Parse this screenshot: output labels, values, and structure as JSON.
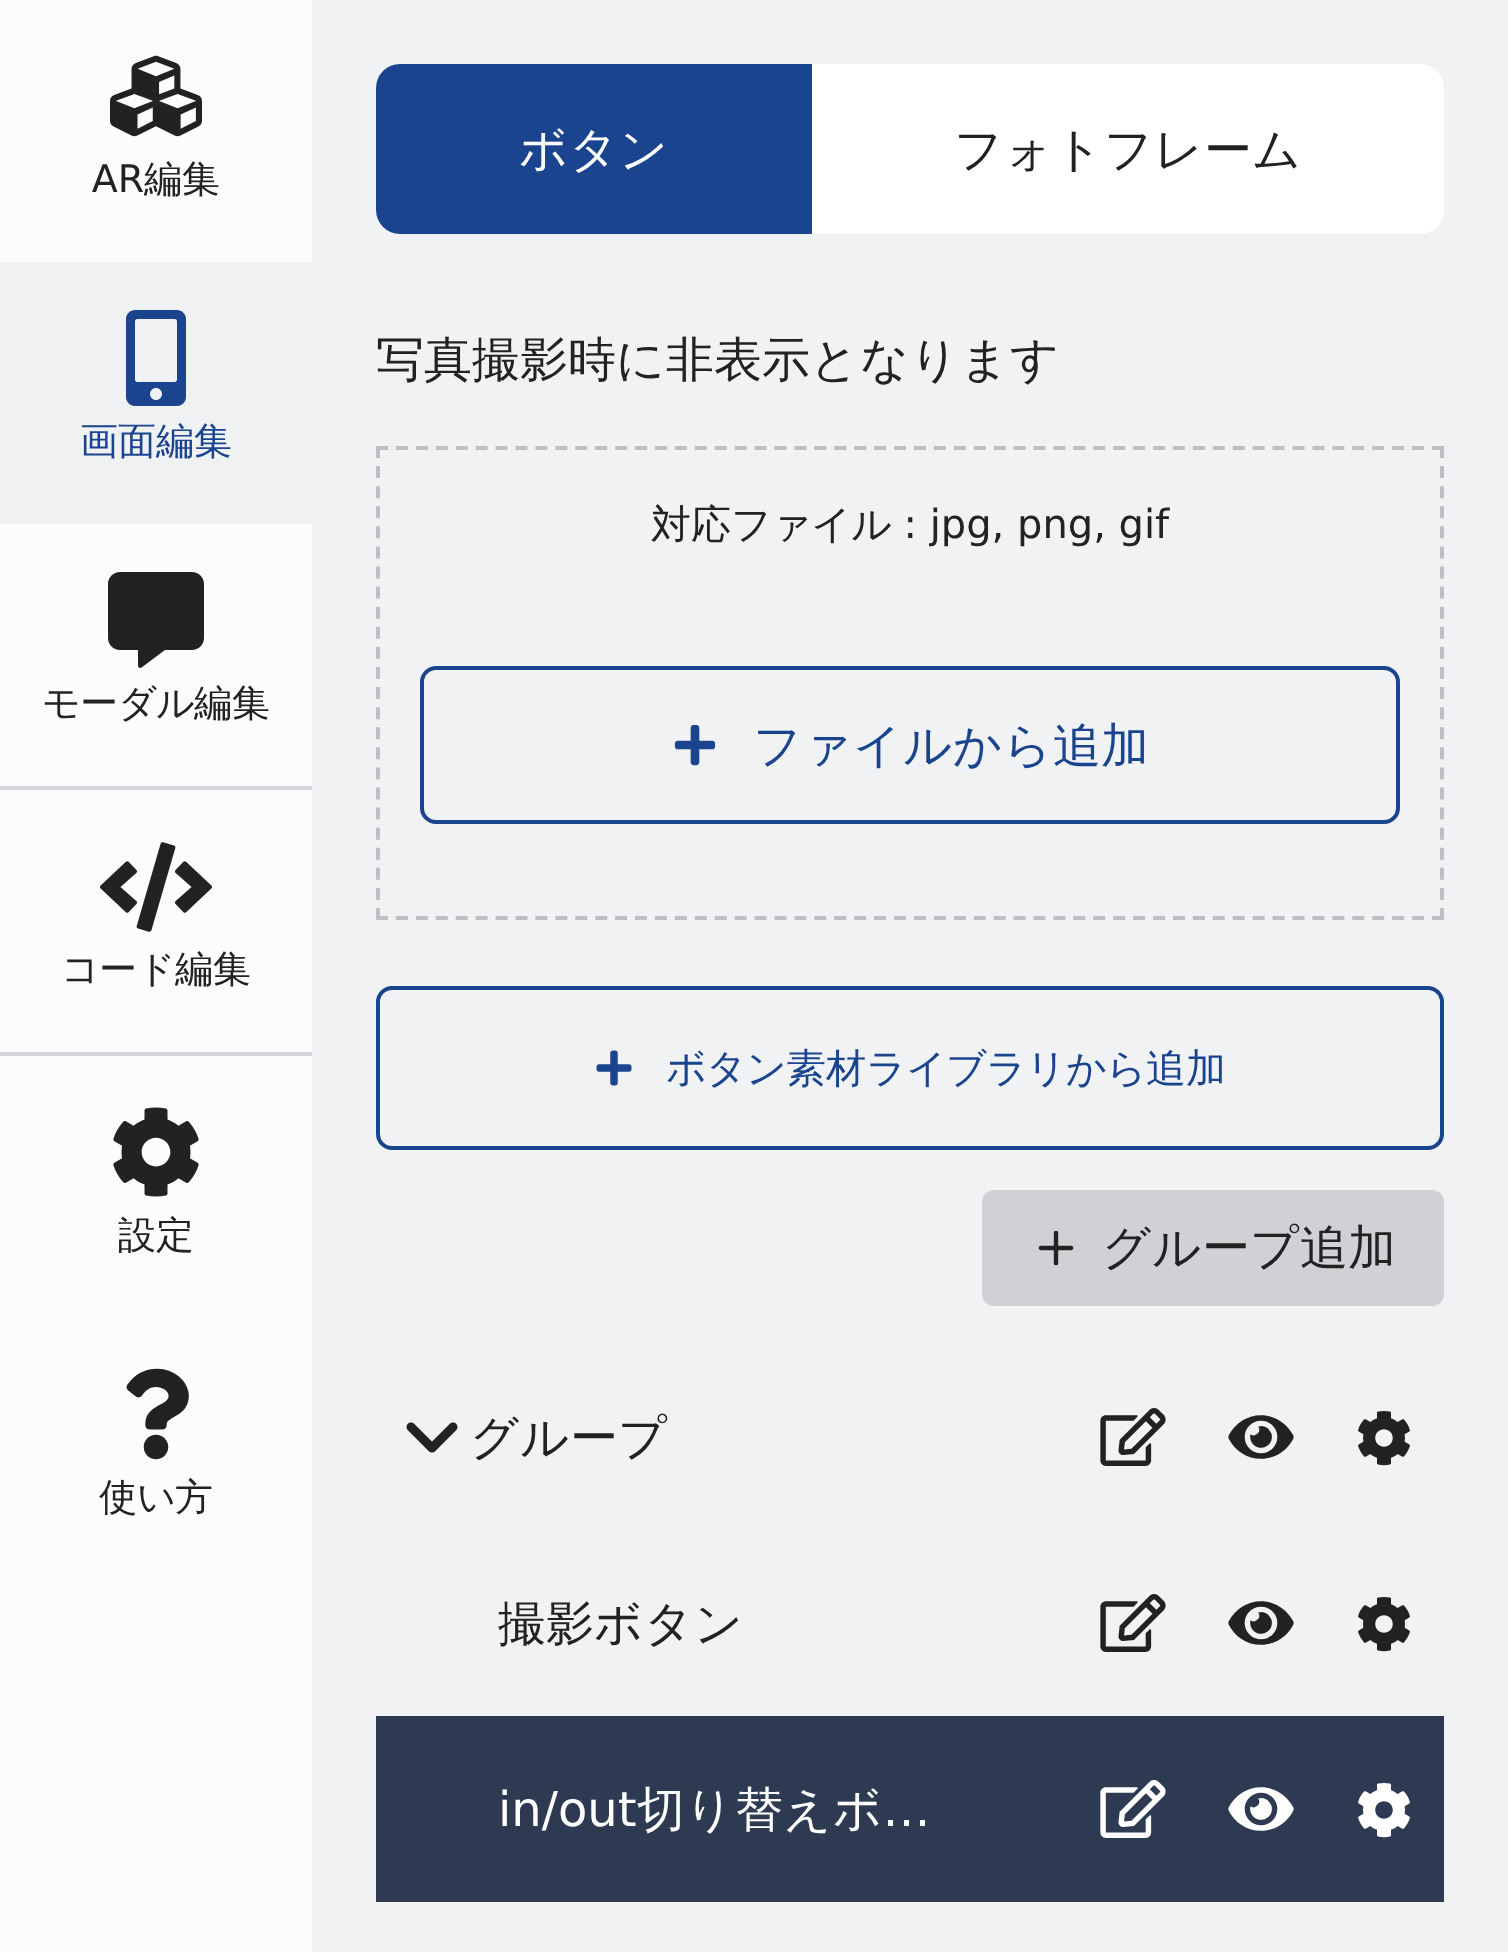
{
  "sidebar": {
    "sections": [
      {
        "items": [
          {
            "label": "AR編集",
            "selected": false
          },
          {
            "label": "画面編集",
            "selected": true
          },
          {
            "label": "モーダル編集",
            "selected": false
          }
        ]
      },
      {
        "items": [
          {
            "label": "コード編集",
            "selected": false
          }
        ]
      },
      {
        "items": [
          {
            "label": "設定",
            "selected": false
          },
          {
            "label": "使い方",
            "selected": false
          }
        ]
      }
    ]
  },
  "tabs": [
    {
      "label": "ボタン",
      "selected": true
    },
    {
      "label": "フォトフレーム",
      "selected": false
    }
  ],
  "notice": "写真撮影時に非表示となります",
  "upload": {
    "formats": "対応ファイル : jpg, png, gif",
    "button": "ファイルから追加"
  },
  "library_button": "ボタン素材ライブラリから追加",
  "add_group_button": "グループ追加",
  "tree": [
    {
      "label": "グループ",
      "expanded": true,
      "selected": false,
      "children": [
        {
          "label": "撮影ボタン",
          "selected": false
        },
        {
          "label": "in/out切り替えボ…",
          "selected": true
        }
      ]
    }
  ]
}
